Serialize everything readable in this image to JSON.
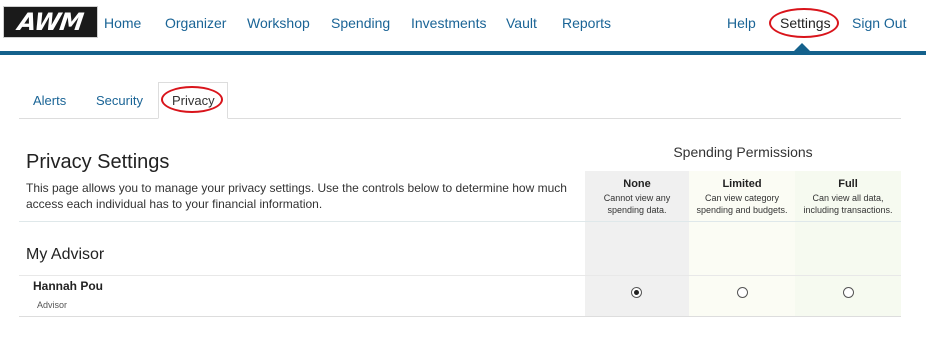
{
  "logo": {
    "text": "AWM"
  },
  "nav": {
    "items": [
      "Home",
      "Organizer",
      "Workshop",
      "Spending",
      "Investments",
      "Vault",
      "Reports"
    ],
    "right": [
      "Help",
      "Settings",
      "Sign Out"
    ],
    "active": "Settings"
  },
  "subtabs": {
    "items": [
      "Alerts",
      "Security",
      "Privacy"
    ],
    "active": "Privacy"
  },
  "privacy": {
    "title": "Privacy Settings",
    "description": "This page allows you to manage your privacy settings.  Use the controls below to determine how much access each individual has to your financial information."
  },
  "permissions": {
    "title": "Spending Permissions",
    "columns": [
      {
        "name": "None",
        "desc_line1": "Cannot view any",
        "desc_line2": "spending data."
      },
      {
        "name": "Limited",
        "desc_line1": "Can view category",
        "desc_line2": "spending and budgets."
      },
      {
        "name": "Full",
        "desc_line1": "Can view all data,",
        "desc_line2": "including transactions."
      }
    ]
  },
  "section": {
    "title": "My Advisor",
    "people": [
      {
        "name": "Hannah Pou",
        "role": "Advisor",
        "selected": "None"
      }
    ]
  },
  "colors": {
    "nav_link": "#1a6496",
    "nav_bar": "#14618c",
    "highlight_circle": "#d9141b"
  }
}
